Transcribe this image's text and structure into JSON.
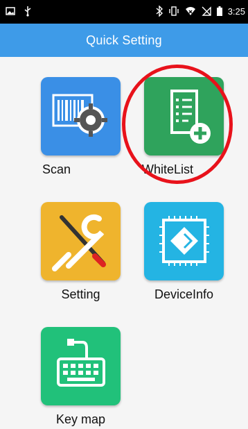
{
  "status_bar": {
    "time": "3:25",
    "left_icons": [
      "image-icon",
      "usb-icon"
    ],
    "right_icons": [
      "bluetooth-icon",
      "vibrate-icon",
      "wifi-icon",
      "no-sim-icon",
      "battery-icon"
    ]
  },
  "header": {
    "title": "Quick Setting"
  },
  "apps": [
    {
      "label": "Scan",
      "icon": "barcode-gear-icon",
      "color": "#3a8fe6"
    },
    {
      "label": "WhiteList",
      "icon": "checklist-add-icon",
      "color": "#2fa35c"
    },
    {
      "label": "Setting",
      "icon": "tools-icon",
      "color": "#efb42d"
    },
    {
      "label": "DeviceInfo",
      "icon": "chip-icon",
      "color": "#24b4e3"
    },
    {
      "label": "Key map",
      "icon": "keyboard-icon",
      "color": "#21c17a"
    }
  ],
  "annotation": {
    "highlight_color": "#e8121b",
    "highlighted_app": "WhiteList"
  }
}
